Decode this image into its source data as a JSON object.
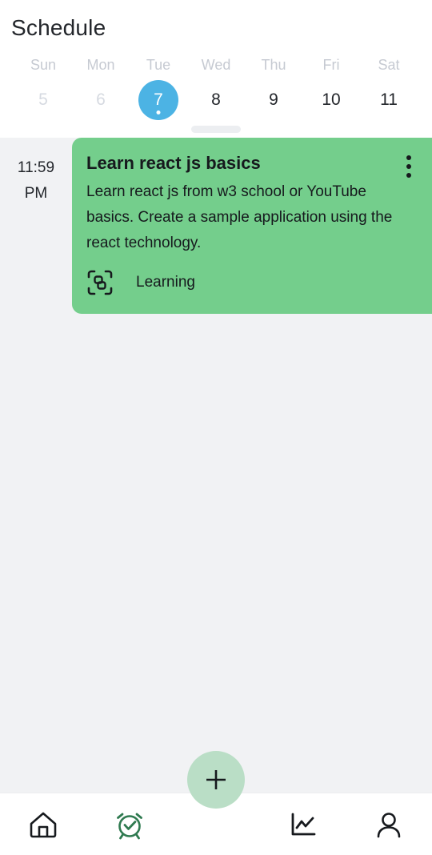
{
  "header": {
    "title": "Schedule"
  },
  "calendar": {
    "days": [
      {
        "dow": "Sun",
        "num": "5",
        "state": "past"
      },
      {
        "dow": "Mon",
        "num": "6",
        "state": "past"
      },
      {
        "dow": "Tue",
        "num": "7",
        "state": "selected"
      },
      {
        "dow": "Wed",
        "num": "8",
        "state": "normal"
      },
      {
        "dow": "Thu",
        "num": "9",
        "state": "normal"
      },
      {
        "dow": "Fri",
        "num": "10",
        "state": "normal"
      },
      {
        "dow": "Sat",
        "num": "11",
        "state": "normal"
      }
    ],
    "selected_accent": "#4cb3e4"
  },
  "schedule": {
    "event": {
      "time_hour": "11:59",
      "time_meridiem": "PM",
      "title": "Learn react js basics",
      "description": "Learn react js from w3 school or YouTube basics. Create a sample application using the react technology.",
      "category_label": "Learning",
      "category_icon": "scan-nodes-icon",
      "card_color": "#74ce8c",
      "overflow_icon": "more-vertical-icon"
    }
  },
  "fab": {
    "icon": "plus-icon",
    "color": "#badec6"
  },
  "bottom_nav": {
    "items": [
      {
        "icon": "home-icon",
        "active": false
      },
      {
        "icon": "alarm-check-icon",
        "active": true
      },
      {
        "icon": "chart-line-icon",
        "active": false
      },
      {
        "icon": "person-icon",
        "active": false
      }
    ],
    "active_color": "#2f7a50",
    "inactive_color": "#16191d"
  }
}
